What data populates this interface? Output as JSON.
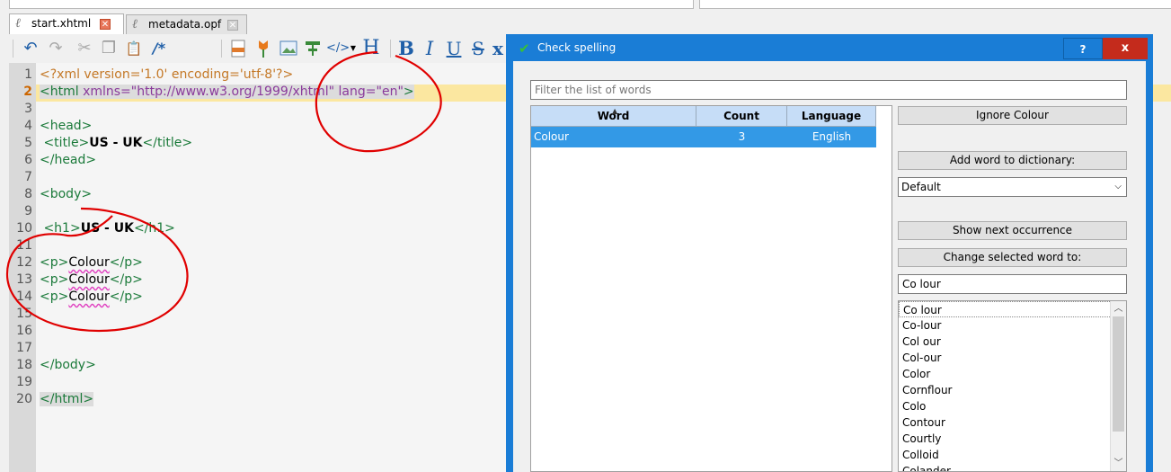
{
  "tabs": [
    {
      "label": "start.xhtml",
      "close": "✕"
    },
    {
      "label": "metadata.opf",
      "close": "✕"
    }
  ],
  "editor": {
    "current_line": 2,
    "lines": [
      {
        "n": "1"
      },
      {
        "n": "2"
      },
      {
        "n": "3"
      },
      {
        "n": "4"
      },
      {
        "n": "5"
      },
      {
        "n": "6"
      },
      {
        "n": "7"
      },
      {
        "n": "8"
      },
      {
        "n": "9"
      },
      {
        "n": "10"
      },
      {
        "n": "11"
      },
      {
        "n": "12"
      },
      {
        "n": "13"
      },
      {
        "n": "14"
      },
      {
        "n": "15"
      },
      {
        "n": "16"
      },
      {
        "n": "17"
      },
      {
        "n": "18"
      },
      {
        "n": "19"
      },
      {
        "n": "20"
      }
    ],
    "code": {
      "l1": "<?xml version='1.0' encoding='utf-8'?>",
      "l2_open": "<html ",
      "l2_attr1": "xmlns=",
      "l2_val1": "\"http://www.w3.org/1999/xhtml\"",
      "l2_attr2": " lang=",
      "l2_val2": "\"en\"",
      "l2_close": ">",
      "l4": "<head>",
      "l5_open": "<title>",
      "l5_text": "US - UK",
      "l5_close": "</title>",
      "l6": "</head>",
      "l8": "<body>",
      "l10_open": "<h1>",
      "l10_text": "US - UK",
      "l10_close": "</h1>",
      "p_open": "<p>",
      "p_word": "Colour",
      "p_close": "</p>",
      "l18": "</body>",
      "l20": "</html>"
    }
  },
  "toolbar": {
    "undo": "↶",
    "redo": "↷",
    "cut": "✂",
    "copy": "❐",
    "paste": "📋",
    "comment": "/*",
    "code_tag": "</>",
    "heading": "H",
    "bold": "B",
    "italic": "I",
    "underline": "U",
    "strike": "S",
    "x": "x"
  },
  "dialog": {
    "title": "Check spelling",
    "help": "?",
    "close": "x",
    "filter_placeholder": "Filter the list of words",
    "table": {
      "headers": [
        "Word",
        "Count",
        "Language"
      ],
      "rows": [
        {
          "word": "Colour",
          "count": "3",
          "language": "English"
        }
      ]
    },
    "ignore_button": "Ignore Colour",
    "add_word_button": "Add word to dictionary:",
    "dictionary_value": "Default",
    "show_next_button": "Show next occurrence",
    "change_word_button": "Change selected word to:",
    "change_value": "Co lour",
    "suggestions": [
      "Co lour",
      "Co-lour",
      "Col our",
      "Col-our",
      "Color",
      "Cornflour",
      "Colo",
      "Contour",
      "Courtly",
      "Colloid",
      "Colander"
    ]
  },
  "colors": {
    "dialog_title_bar": "#1a7dd6",
    "close_button": "#c42b1c",
    "selected_row": "#3399e6",
    "current_line": "#fbe7a0",
    "annotation": "#e00000"
  }
}
